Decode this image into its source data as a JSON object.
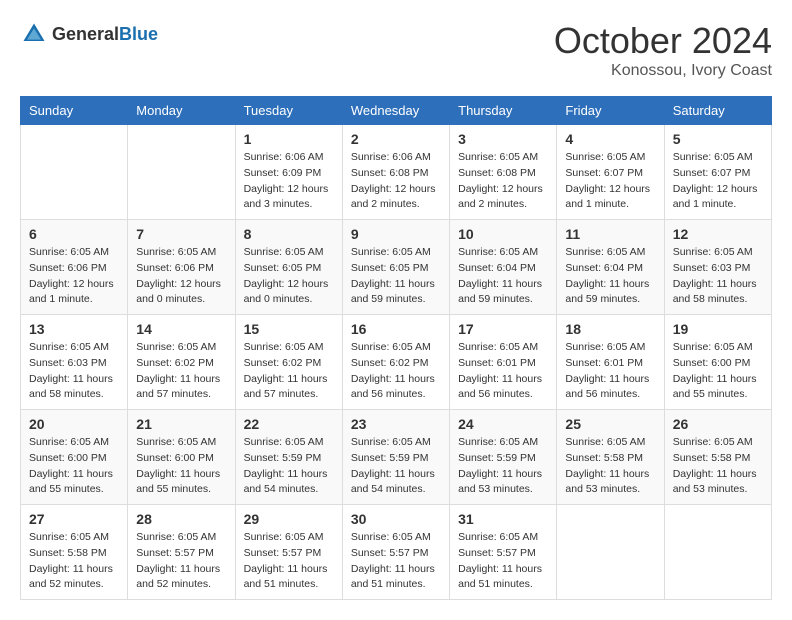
{
  "logo": {
    "text_general": "General",
    "text_blue": "Blue"
  },
  "title": {
    "month_year": "October 2024",
    "location": "Konossou, Ivory Coast"
  },
  "weekdays": [
    "Sunday",
    "Monday",
    "Tuesday",
    "Wednesday",
    "Thursday",
    "Friday",
    "Saturday"
  ],
  "weeks": [
    [
      {
        "day": "",
        "info": ""
      },
      {
        "day": "",
        "info": ""
      },
      {
        "day": "1",
        "info": "Sunrise: 6:06 AM\nSunset: 6:09 PM\nDaylight: 12 hours\nand 3 minutes."
      },
      {
        "day": "2",
        "info": "Sunrise: 6:06 AM\nSunset: 6:08 PM\nDaylight: 12 hours\nand 2 minutes."
      },
      {
        "day": "3",
        "info": "Sunrise: 6:05 AM\nSunset: 6:08 PM\nDaylight: 12 hours\nand 2 minutes."
      },
      {
        "day": "4",
        "info": "Sunrise: 6:05 AM\nSunset: 6:07 PM\nDaylight: 12 hours\nand 1 minute."
      },
      {
        "day": "5",
        "info": "Sunrise: 6:05 AM\nSunset: 6:07 PM\nDaylight: 12 hours\nand 1 minute."
      }
    ],
    [
      {
        "day": "6",
        "info": "Sunrise: 6:05 AM\nSunset: 6:06 PM\nDaylight: 12 hours\nand 1 minute."
      },
      {
        "day": "7",
        "info": "Sunrise: 6:05 AM\nSunset: 6:06 PM\nDaylight: 12 hours\nand 0 minutes."
      },
      {
        "day": "8",
        "info": "Sunrise: 6:05 AM\nSunset: 6:05 PM\nDaylight: 12 hours\nand 0 minutes."
      },
      {
        "day": "9",
        "info": "Sunrise: 6:05 AM\nSunset: 6:05 PM\nDaylight: 11 hours\nand 59 minutes."
      },
      {
        "day": "10",
        "info": "Sunrise: 6:05 AM\nSunset: 6:04 PM\nDaylight: 11 hours\nand 59 minutes."
      },
      {
        "day": "11",
        "info": "Sunrise: 6:05 AM\nSunset: 6:04 PM\nDaylight: 11 hours\nand 59 minutes."
      },
      {
        "day": "12",
        "info": "Sunrise: 6:05 AM\nSunset: 6:03 PM\nDaylight: 11 hours\nand 58 minutes."
      }
    ],
    [
      {
        "day": "13",
        "info": "Sunrise: 6:05 AM\nSunset: 6:03 PM\nDaylight: 11 hours\nand 58 minutes."
      },
      {
        "day": "14",
        "info": "Sunrise: 6:05 AM\nSunset: 6:02 PM\nDaylight: 11 hours\nand 57 minutes."
      },
      {
        "day": "15",
        "info": "Sunrise: 6:05 AM\nSunset: 6:02 PM\nDaylight: 11 hours\nand 57 minutes."
      },
      {
        "day": "16",
        "info": "Sunrise: 6:05 AM\nSunset: 6:02 PM\nDaylight: 11 hours\nand 56 minutes."
      },
      {
        "day": "17",
        "info": "Sunrise: 6:05 AM\nSunset: 6:01 PM\nDaylight: 11 hours\nand 56 minutes."
      },
      {
        "day": "18",
        "info": "Sunrise: 6:05 AM\nSunset: 6:01 PM\nDaylight: 11 hours\nand 56 minutes."
      },
      {
        "day": "19",
        "info": "Sunrise: 6:05 AM\nSunset: 6:00 PM\nDaylight: 11 hours\nand 55 minutes."
      }
    ],
    [
      {
        "day": "20",
        "info": "Sunrise: 6:05 AM\nSunset: 6:00 PM\nDaylight: 11 hours\nand 55 minutes."
      },
      {
        "day": "21",
        "info": "Sunrise: 6:05 AM\nSunset: 6:00 PM\nDaylight: 11 hours\nand 55 minutes."
      },
      {
        "day": "22",
        "info": "Sunrise: 6:05 AM\nSunset: 5:59 PM\nDaylight: 11 hours\nand 54 minutes."
      },
      {
        "day": "23",
        "info": "Sunrise: 6:05 AM\nSunset: 5:59 PM\nDaylight: 11 hours\nand 54 minutes."
      },
      {
        "day": "24",
        "info": "Sunrise: 6:05 AM\nSunset: 5:59 PM\nDaylight: 11 hours\nand 53 minutes."
      },
      {
        "day": "25",
        "info": "Sunrise: 6:05 AM\nSunset: 5:58 PM\nDaylight: 11 hours\nand 53 minutes."
      },
      {
        "day": "26",
        "info": "Sunrise: 6:05 AM\nSunset: 5:58 PM\nDaylight: 11 hours\nand 53 minutes."
      }
    ],
    [
      {
        "day": "27",
        "info": "Sunrise: 6:05 AM\nSunset: 5:58 PM\nDaylight: 11 hours\nand 52 minutes."
      },
      {
        "day": "28",
        "info": "Sunrise: 6:05 AM\nSunset: 5:57 PM\nDaylight: 11 hours\nand 52 minutes."
      },
      {
        "day": "29",
        "info": "Sunrise: 6:05 AM\nSunset: 5:57 PM\nDaylight: 11 hours\nand 51 minutes."
      },
      {
        "day": "30",
        "info": "Sunrise: 6:05 AM\nSunset: 5:57 PM\nDaylight: 11 hours\nand 51 minutes."
      },
      {
        "day": "31",
        "info": "Sunrise: 6:05 AM\nSunset: 5:57 PM\nDaylight: 11 hours\nand 51 minutes."
      },
      {
        "day": "",
        "info": ""
      },
      {
        "day": "",
        "info": ""
      }
    ]
  ]
}
